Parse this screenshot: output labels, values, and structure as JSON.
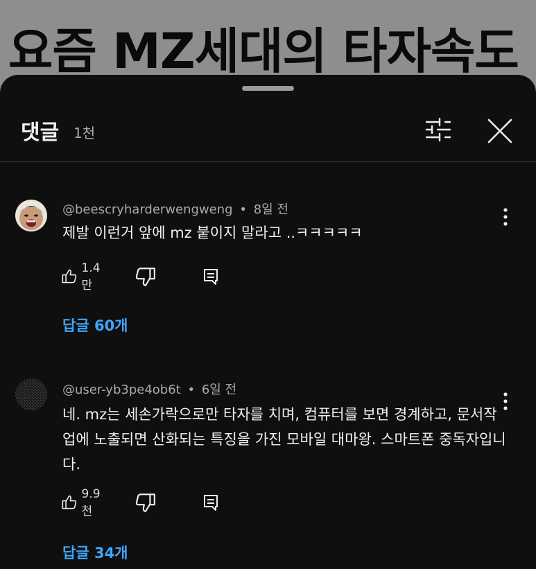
{
  "video": {
    "title": "요즘 MZ세대의 타자속도"
  },
  "comments_panel": {
    "title": "댓글",
    "count": "1천",
    "icons": {
      "filter": "sliders-icon",
      "close": "close-icon"
    }
  },
  "comments": [
    {
      "author": "@beescryharderwengweng",
      "separator": "•",
      "time": "8일 전",
      "text": "제발 이런거 앞에 mz 붙이지 말라고 ..ㅋㅋㅋㅋㅋ",
      "likes": "1.4만",
      "replies_label": "답글 60개"
    },
    {
      "author": "@user-yb3pe4ob6t",
      "separator": "•",
      "time": "6일 전",
      "text": "네. mz는 세손가락으로만 타자를 치며, 컴퓨터를 보면 경계하고, 문서작업에 노출되면 산화되는 특징을 가진 모바일 대마왕. 스마트폰 중독자입니다.",
      "likes": "9.9천",
      "replies_label": "답글 34개"
    }
  ],
  "colors": {
    "sheet_background": "#0f0f0f",
    "primary_text": "#f1f1f1",
    "secondary_text": "#aaaaaa",
    "link_accent": "#3ea6ff"
  }
}
